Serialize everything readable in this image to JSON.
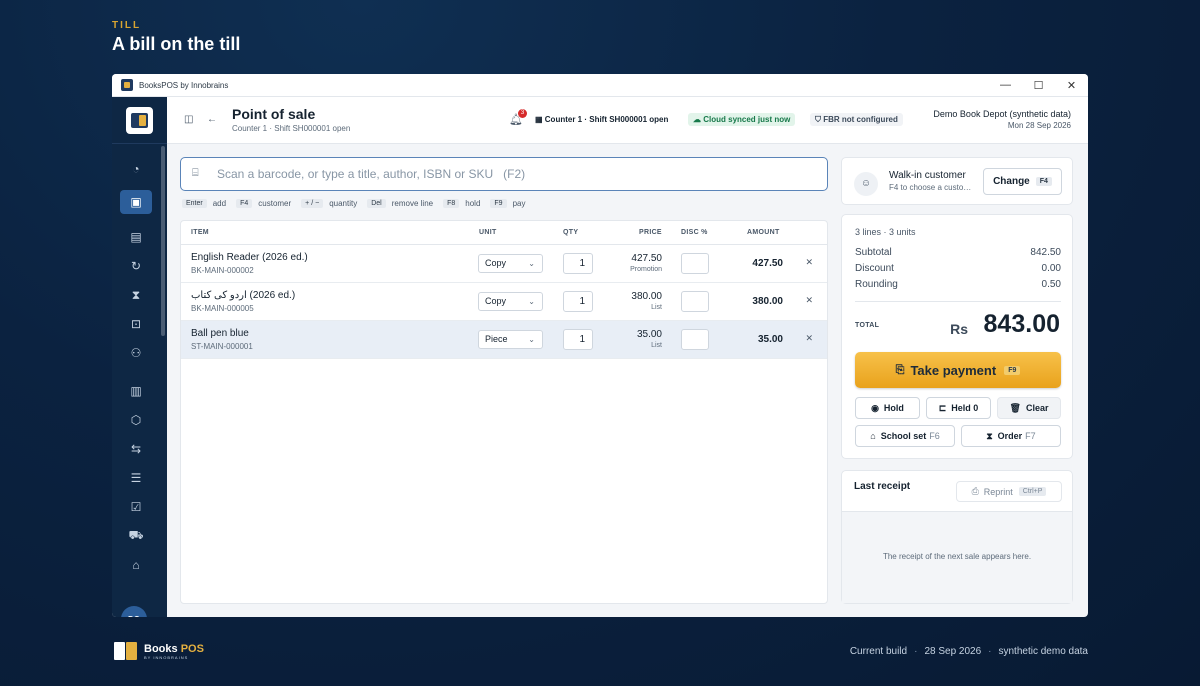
{
  "page": {
    "eyebrow": "TILL",
    "headline": "A bill on the till"
  },
  "window": {
    "title": "BooksPOS by Innobrains",
    "controls": [
      "—",
      "☐",
      "✕"
    ]
  },
  "header": {
    "title": "Point of sale",
    "subtitle": "Counter 1 · Shift SH000001 open",
    "notifications_count": "3",
    "counter_status": "Counter 1 · Shift SH000001 open",
    "sync_status": "Cloud synced just now",
    "fbr_status": "FBR not configured",
    "store_name": "Demo Book Depot (synthetic data)",
    "date": "Mon 28 Sep 2026"
  },
  "sidebar": {
    "items": [
      {
        "icon": "dashboard-icon",
        "glyph": "◔",
        "active": false
      },
      {
        "icon": "scan-icon",
        "glyph": "▣",
        "active": true
      },
      {
        "icon": "receipt-icon",
        "glyph": "▤",
        "active": false
      },
      {
        "icon": "refresh-icon",
        "glyph": "↻",
        "active": false
      },
      {
        "icon": "hourglass-icon",
        "glyph": "⧗",
        "active": false
      },
      {
        "icon": "school-bag-icon",
        "glyph": "⊡",
        "active": false
      },
      {
        "icon": "users-icon",
        "glyph": "⚇",
        "active": false
      },
      {
        "icon": "book-icon",
        "glyph": "▥",
        "active": false
      },
      {
        "icon": "box-icon",
        "glyph": "⬡",
        "active": false
      },
      {
        "icon": "transfer-icon",
        "glyph": "⇆",
        "active": false
      },
      {
        "icon": "sliders-icon",
        "glyph": "☰",
        "active": false
      },
      {
        "icon": "clipboard-icon",
        "glyph": "☑",
        "active": false
      },
      {
        "icon": "truck-icon",
        "glyph": "⛟",
        "active": false
      },
      {
        "icon": "tag-icon",
        "glyph": "⌂",
        "active": false
      }
    ],
    "avatar_initials": "DO"
  },
  "search": {
    "placeholder": "Scan a barcode, or type a title, author, ISBN or SKU   (F2)",
    "value": ""
  },
  "shortcuts": [
    {
      "key": "Enter",
      "label": "add"
    },
    {
      "key": "F4",
      "label": "customer"
    },
    {
      "key": "+ / −",
      "label": "quantity"
    },
    {
      "key": "Del",
      "label": "remove line"
    },
    {
      "key": "F8",
      "label": "hold"
    },
    {
      "key": "F9",
      "label": "pay"
    }
  ],
  "table": {
    "columns": {
      "item": "ITEM",
      "unit": "UNIT",
      "qty": "QTY",
      "price": "PRICE",
      "disc": "DISC %",
      "amount": "AMOUNT"
    },
    "rows": [
      {
        "name": "English Reader (2026 ed.)",
        "sku": "BK-MAIN-000002",
        "unit": "Copy",
        "qty": "1",
        "price": "427.50",
        "price_source": "Promotion",
        "disc": "",
        "amount": "427.50",
        "selected": false
      },
      {
        "name": "اردو کی کتاب (2026 ed.)",
        "sku": "BK-MAIN-000005",
        "unit": "Copy",
        "qty": "1",
        "price": "380.00",
        "price_source": "List",
        "disc": "",
        "amount": "380.00",
        "selected": false
      },
      {
        "name": "Ball pen blue",
        "sku": "ST-MAIN-000001",
        "unit": "Piece",
        "qty": "1",
        "price": "35.00",
        "price_source": "List",
        "disc": "",
        "amount": "35.00",
        "selected": true
      }
    ]
  },
  "customer": {
    "name": "Walk-in customer",
    "hint": "F4 to choose a customer",
    "change_label": "Change",
    "change_key": "F4"
  },
  "totals": {
    "lines_summary": "3 lines · 3 units",
    "subtotal_label": "Subtotal",
    "subtotal": "842.50",
    "discount_label": "Discount",
    "discount": "0.00",
    "rounding_label": "Rounding",
    "rounding": "0.50",
    "total_label": "TOTAL",
    "currency": "Rs",
    "total": "843.00"
  },
  "actions": {
    "pay_label": "Take payment",
    "pay_key": "F9",
    "hold_label": "Hold",
    "held_label": "Held 0",
    "clear_label": "Clear",
    "school_set_label": "School set",
    "school_set_key": "F6",
    "order_label": "Order",
    "order_key": "F7"
  },
  "receipt": {
    "title": "Last receipt",
    "reprint_label": "Reprint",
    "reprint_key": "Ctrl+P",
    "empty_text": "The receipt of the next sale appears here."
  },
  "footer": {
    "brand": "Books",
    "brand_accent": "POS",
    "brand_by": "BY INNOBRAINS",
    "build": "Current build",
    "build_date": "28 Sep 2026",
    "data_note": "synthetic demo data"
  },
  "colors": {
    "accent": "#2c5e9a",
    "pay": "#f0b030",
    "sidebar": "#0e2744",
    "sync_green": "#17794a",
    "badge_red": "#d62b2b"
  }
}
